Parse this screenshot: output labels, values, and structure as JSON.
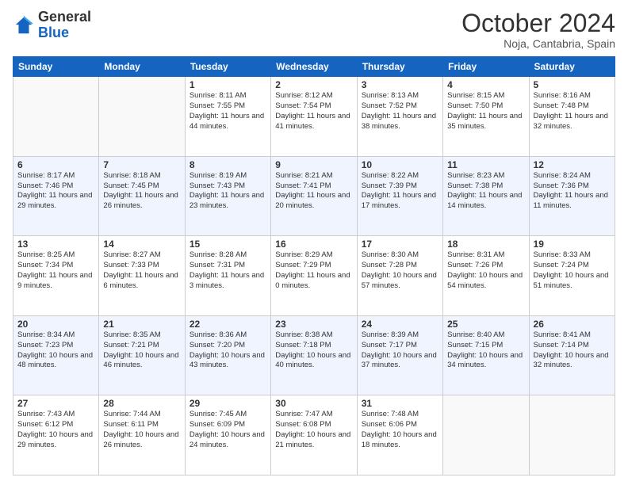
{
  "logo": {
    "general": "General",
    "blue": "Blue"
  },
  "header": {
    "month": "October 2024",
    "location": "Noja, Cantabria, Spain"
  },
  "weekdays": [
    "Sunday",
    "Monday",
    "Tuesday",
    "Wednesday",
    "Thursday",
    "Friday",
    "Saturday"
  ],
  "weeks": [
    [
      {
        "day": "",
        "sunrise": "",
        "sunset": "",
        "daylight": ""
      },
      {
        "day": "",
        "sunrise": "",
        "sunset": "",
        "daylight": ""
      },
      {
        "day": "1",
        "sunrise": "Sunrise: 8:11 AM",
        "sunset": "Sunset: 7:55 PM",
        "daylight": "Daylight: 11 hours and 44 minutes."
      },
      {
        "day": "2",
        "sunrise": "Sunrise: 8:12 AM",
        "sunset": "Sunset: 7:54 PM",
        "daylight": "Daylight: 11 hours and 41 minutes."
      },
      {
        "day": "3",
        "sunrise": "Sunrise: 8:13 AM",
        "sunset": "Sunset: 7:52 PM",
        "daylight": "Daylight: 11 hours and 38 minutes."
      },
      {
        "day": "4",
        "sunrise": "Sunrise: 8:15 AM",
        "sunset": "Sunset: 7:50 PM",
        "daylight": "Daylight: 11 hours and 35 minutes."
      },
      {
        "day": "5",
        "sunrise": "Sunrise: 8:16 AM",
        "sunset": "Sunset: 7:48 PM",
        "daylight": "Daylight: 11 hours and 32 minutes."
      }
    ],
    [
      {
        "day": "6",
        "sunrise": "Sunrise: 8:17 AM",
        "sunset": "Sunset: 7:46 PM",
        "daylight": "Daylight: 11 hours and 29 minutes."
      },
      {
        "day": "7",
        "sunrise": "Sunrise: 8:18 AM",
        "sunset": "Sunset: 7:45 PM",
        "daylight": "Daylight: 11 hours and 26 minutes."
      },
      {
        "day": "8",
        "sunrise": "Sunrise: 8:19 AM",
        "sunset": "Sunset: 7:43 PM",
        "daylight": "Daylight: 11 hours and 23 minutes."
      },
      {
        "day": "9",
        "sunrise": "Sunrise: 8:21 AM",
        "sunset": "Sunset: 7:41 PM",
        "daylight": "Daylight: 11 hours and 20 minutes."
      },
      {
        "day": "10",
        "sunrise": "Sunrise: 8:22 AM",
        "sunset": "Sunset: 7:39 PM",
        "daylight": "Daylight: 11 hours and 17 minutes."
      },
      {
        "day": "11",
        "sunrise": "Sunrise: 8:23 AM",
        "sunset": "Sunset: 7:38 PM",
        "daylight": "Daylight: 11 hours and 14 minutes."
      },
      {
        "day": "12",
        "sunrise": "Sunrise: 8:24 AM",
        "sunset": "Sunset: 7:36 PM",
        "daylight": "Daylight: 11 hours and 11 minutes."
      }
    ],
    [
      {
        "day": "13",
        "sunrise": "Sunrise: 8:25 AM",
        "sunset": "Sunset: 7:34 PM",
        "daylight": "Daylight: 11 hours and 9 minutes."
      },
      {
        "day": "14",
        "sunrise": "Sunrise: 8:27 AM",
        "sunset": "Sunset: 7:33 PM",
        "daylight": "Daylight: 11 hours and 6 minutes."
      },
      {
        "day": "15",
        "sunrise": "Sunrise: 8:28 AM",
        "sunset": "Sunset: 7:31 PM",
        "daylight": "Daylight: 11 hours and 3 minutes."
      },
      {
        "day": "16",
        "sunrise": "Sunrise: 8:29 AM",
        "sunset": "Sunset: 7:29 PM",
        "daylight": "Daylight: 11 hours and 0 minutes."
      },
      {
        "day": "17",
        "sunrise": "Sunrise: 8:30 AM",
        "sunset": "Sunset: 7:28 PM",
        "daylight": "Daylight: 10 hours and 57 minutes."
      },
      {
        "day": "18",
        "sunrise": "Sunrise: 8:31 AM",
        "sunset": "Sunset: 7:26 PM",
        "daylight": "Daylight: 10 hours and 54 minutes."
      },
      {
        "day": "19",
        "sunrise": "Sunrise: 8:33 AM",
        "sunset": "Sunset: 7:24 PM",
        "daylight": "Daylight: 10 hours and 51 minutes."
      }
    ],
    [
      {
        "day": "20",
        "sunrise": "Sunrise: 8:34 AM",
        "sunset": "Sunset: 7:23 PM",
        "daylight": "Daylight: 10 hours and 48 minutes."
      },
      {
        "day": "21",
        "sunrise": "Sunrise: 8:35 AM",
        "sunset": "Sunset: 7:21 PM",
        "daylight": "Daylight: 10 hours and 46 minutes."
      },
      {
        "day": "22",
        "sunrise": "Sunrise: 8:36 AM",
        "sunset": "Sunset: 7:20 PM",
        "daylight": "Daylight: 10 hours and 43 minutes."
      },
      {
        "day": "23",
        "sunrise": "Sunrise: 8:38 AM",
        "sunset": "Sunset: 7:18 PM",
        "daylight": "Daylight: 10 hours and 40 minutes."
      },
      {
        "day": "24",
        "sunrise": "Sunrise: 8:39 AM",
        "sunset": "Sunset: 7:17 PM",
        "daylight": "Daylight: 10 hours and 37 minutes."
      },
      {
        "day": "25",
        "sunrise": "Sunrise: 8:40 AM",
        "sunset": "Sunset: 7:15 PM",
        "daylight": "Daylight: 10 hours and 34 minutes."
      },
      {
        "day": "26",
        "sunrise": "Sunrise: 8:41 AM",
        "sunset": "Sunset: 7:14 PM",
        "daylight": "Daylight: 10 hours and 32 minutes."
      }
    ],
    [
      {
        "day": "27",
        "sunrise": "Sunrise: 7:43 AM",
        "sunset": "Sunset: 6:12 PM",
        "daylight": "Daylight: 10 hours and 29 minutes."
      },
      {
        "day": "28",
        "sunrise": "Sunrise: 7:44 AM",
        "sunset": "Sunset: 6:11 PM",
        "daylight": "Daylight: 10 hours and 26 minutes."
      },
      {
        "day": "29",
        "sunrise": "Sunrise: 7:45 AM",
        "sunset": "Sunset: 6:09 PM",
        "daylight": "Daylight: 10 hours and 24 minutes."
      },
      {
        "day": "30",
        "sunrise": "Sunrise: 7:47 AM",
        "sunset": "Sunset: 6:08 PM",
        "daylight": "Daylight: 10 hours and 21 minutes."
      },
      {
        "day": "31",
        "sunrise": "Sunrise: 7:48 AM",
        "sunset": "Sunset: 6:06 PM",
        "daylight": "Daylight: 10 hours and 18 minutes."
      },
      {
        "day": "",
        "sunrise": "",
        "sunset": "",
        "daylight": ""
      },
      {
        "day": "",
        "sunrise": "",
        "sunset": "",
        "daylight": ""
      }
    ]
  ]
}
